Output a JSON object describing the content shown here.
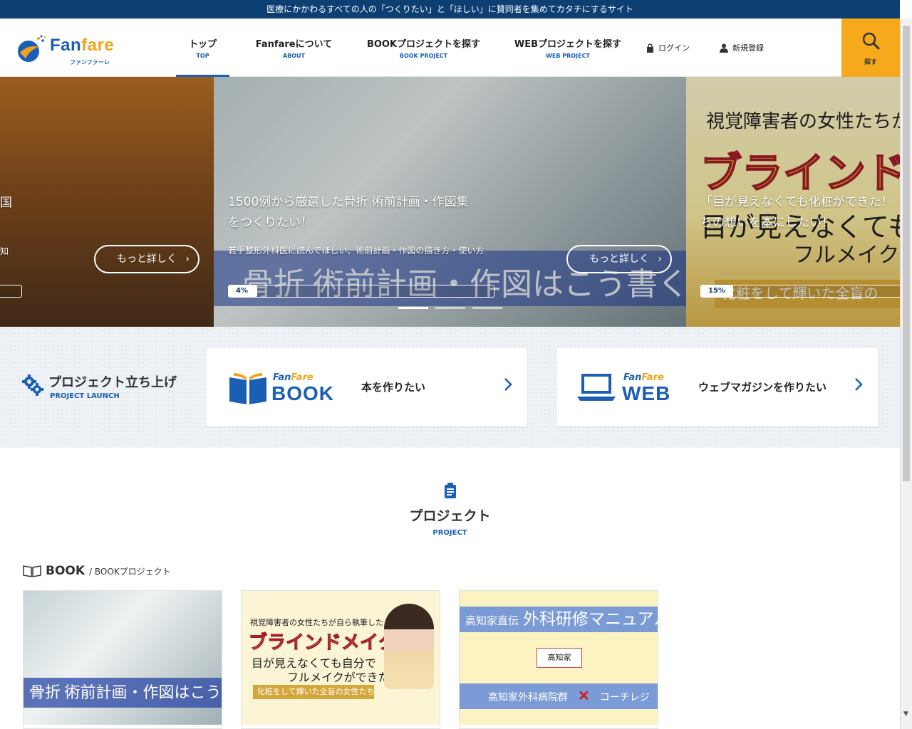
{
  "topbar": {
    "text": "医療にかかわるすべての人の「つくりたい」と「ほしい」に賛同者を集めてカタチにするサイト"
  },
  "header": {
    "logo": {
      "text_main": "Fan",
      "text_accent": "fare",
      "sub": "ファンファーレ"
    },
    "nav": [
      {
        "label": "トップ",
        "sub": "TOP"
      },
      {
        "label": "Fanfareについて",
        "sub": "ABOUT"
      },
      {
        "label": "BOOKプロジェクトを探す",
        "sub": "BOOK PROJECT"
      },
      {
        "label": "WEBプロジェクトを探す",
        "sub": "WEB PROJECT"
      }
    ],
    "login": "ログイン",
    "register": "新規登録",
    "search": "探す"
  },
  "hero": {
    "left": {
      "title_fragment": "国",
      "desc_fragment": "知",
      "more": "もっと詳しく"
    },
    "main": {
      "title_line1": "1500例から厳選した骨折 術前計画・作図集",
      "title_line2": "をつくりたい！",
      "desc": "若手整形外科医に読んでほしい、術前計画・作図の描き方・使い方",
      "more": "もっと詳しく",
      "progress_label": "4%",
      "progress": 4,
      "banner": "骨折 術前計画・作図はこう書く!"
    },
    "right": {
      "top": "視覚障害者の女性たちか",
      "big": "ブラインドメイ",
      "title_line1": "「目が見えなくても化粧ができた！",
      "title_line2": "ちの想いを本にしたい！",
      "mid": "目が見えなくても",
      "mid2": "フルメイク",
      "strip": "化粧をして輝いた全盲の",
      "progress_label": "15%",
      "progress": 15
    }
  },
  "launch": {
    "title": "プロジェクト立ち上げ",
    "subtitle": "PROJECT LAUNCH",
    "book": {
      "brand_small_a": "Fan",
      "brand_small_b": "Fare",
      "brand_big": "BOOK",
      "cta": "本を作りたい"
    },
    "web": {
      "brand_small_a": "Fan",
      "brand_small_b": "Fare",
      "brand_big": "WEB",
      "cta": "ウェブマガジンを作りたい"
    }
  },
  "project_section": {
    "title": "プロジェクト",
    "subtitle": "PROJECT"
  },
  "book_section": {
    "title": "BOOK",
    "subtitle": "/ BOOKプロジェクト"
  },
  "cards": [
    {
      "banner": "骨折 術前計画・作図はこう書く!"
    },
    {
      "line1": "視覚障害者の女性たちが自ら執筆した",
      "line2": "ブラインドメイク物語",
      "line3": "目が見えなくても自分で",
      "line4": "フルメイクができた!",
      "line5": "化粧をして輝いた全盲の女性たち"
    },
    {
      "band_small": "高知家直伝",
      "band_big": "外科研修マニュアル",
      "seal": "高知家",
      "band2_a": "高知家外科病院群",
      "band2_x": "✕",
      "band2_b": "コーチレジ"
    }
  ],
  "colors": {
    "brand_blue": "#1a5fb4",
    "topbar": "#0d3f73",
    "accent_orange": "#f5a91b"
  }
}
